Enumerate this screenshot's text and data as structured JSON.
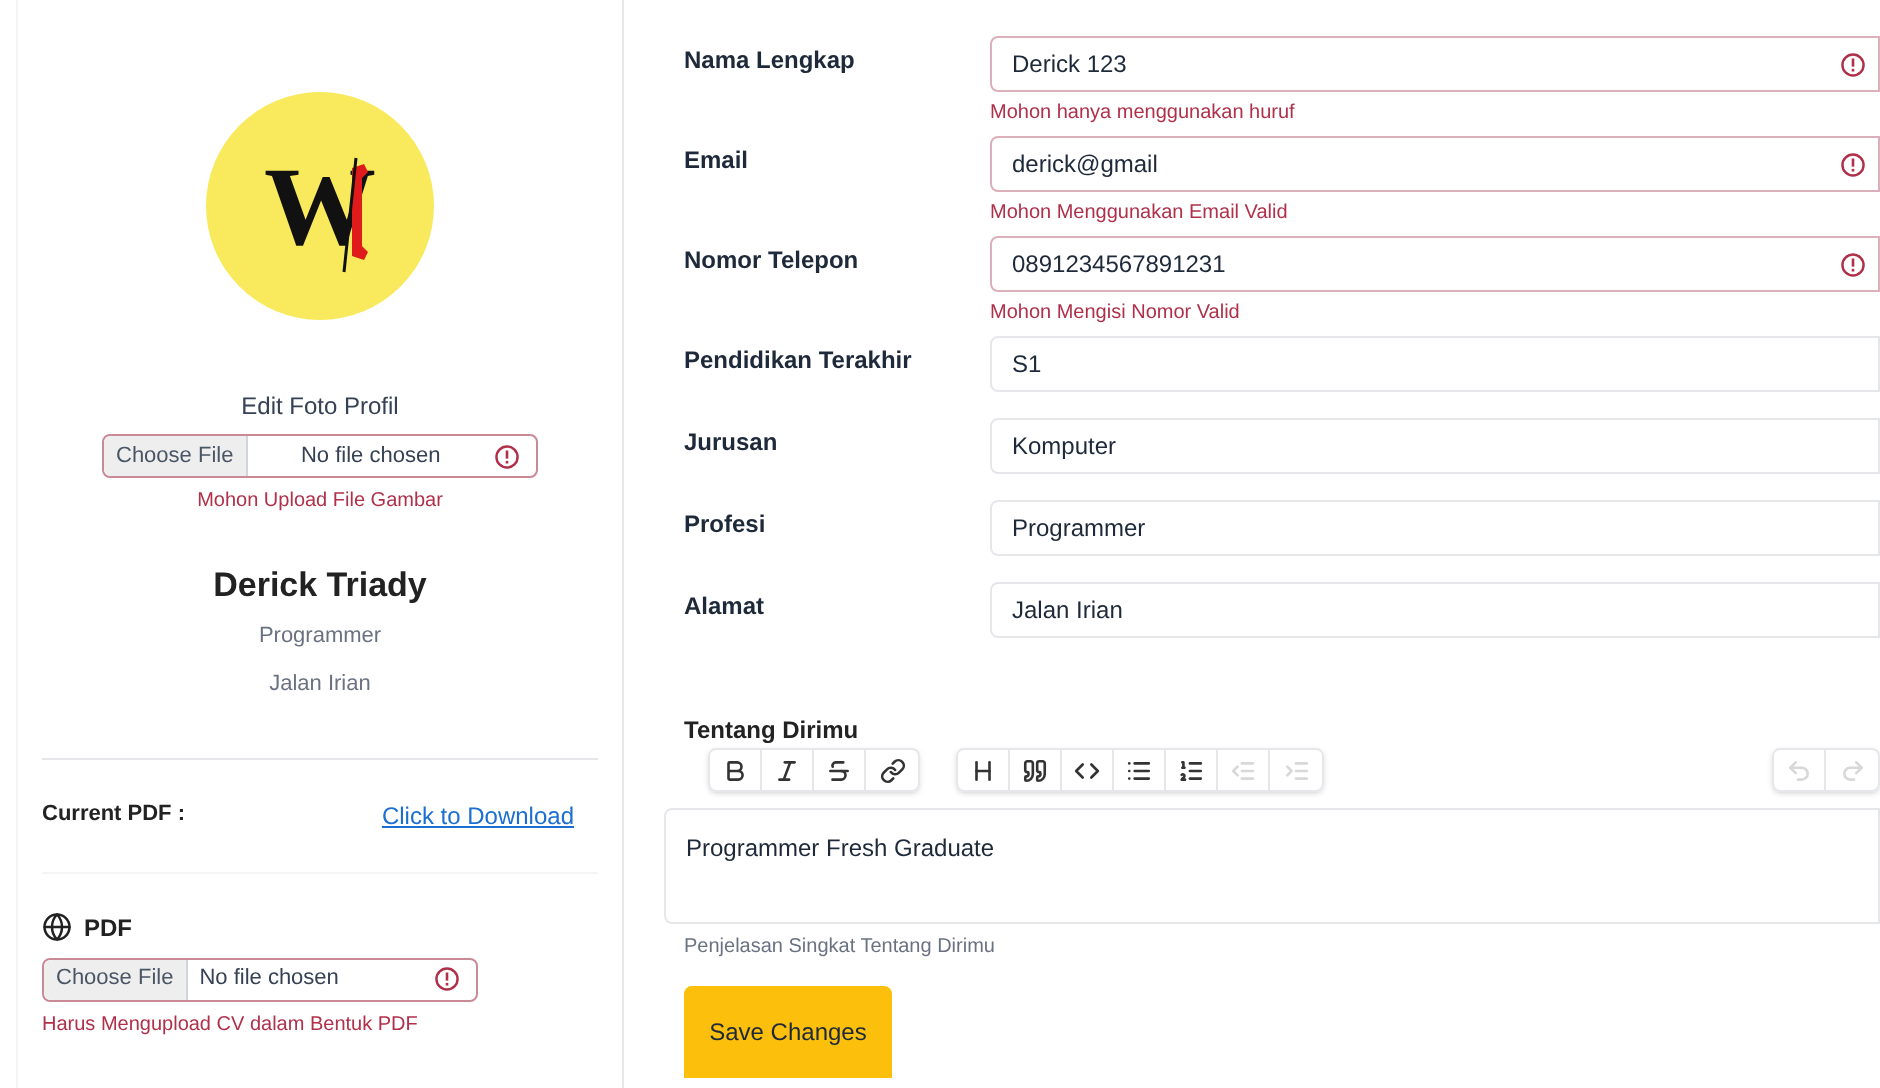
{
  "profile": {
    "logo_letter": "W",
    "photo_label": "Edit Foto Profil",
    "photo_file": {
      "button": "Choose File",
      "value": "No file chosen",
      "invalid": true,
      "error": "Mohon Upload File Gambar"
    },
    "name": "Derick Triady",
    "job": "Programmer",
    "address": "Jalan Irian"
  },
  "pdf": {
    "current_label": "Current PDF :",
    "download_link": "Click to Download",
    "label": "PDF",
    "file": {
      "button": "Choose File",
      "value": "No file chosen",
      "invalid": true,
      "error": "Harus Mengupload CV dalam Bentuk PDF"
    }
  },
  "fields": [
    {
      "label": "Nama Lengkap",
      "value": "Derick 123",
      "invalid": true,
      "error": "Mohon hanya menggunakan huruf"
    },
    {
      "label": "Email",
      "value": "derick@gmail",
      "invalid": true,
      "error": "Mohon Menggunakan Email Valid"
    },
    {
      "label": "Nomor Telepon",
      "value": "0891234567891231",
      "invalid": true,
      "error": "Mohon Mengisi Nomor Valid"
    },
    {
      "label": "Pendidikan Terakhir",
      "value": "S1",
      "invalid": false
    },
    {
      "label": "Jurusan",
      "value": "Komputer",
      "invalid": false
    },
    {
      "label": "Profesi",
      "value": "Programmer",
      "invalid": false
    },
    {
      "label": "Alamat",
      "value": "Jalan Irian",
      "invalid": false
    }
  ],
  "editor": {
    "label": "Tentang Dirimu",
    "toolbar_groups": [
      [
        {
          "kind": "bold",
          "disabled": false
        },
        {
          "kind": "italic",
          "disabled": false
        },
        {
          "kind": "strike",
          "disabled": false
        },
        {
          "kind": "link",
          "disabled": false
        }
      ],
      [
        {
          "kind": "heading",
          "disabled": false
        },
        {
          "kind": "quote",
          "disabled": false
        },
        {
          "kind": "code",
          "disabled": false
        },
        {
          "kind": "bullets",
          "disabled": false
        },
        {
          "kind": "numbers",
          "disabled": false
        },
        {
          "kind": "outdent",
          "disabled": true
        },
        {
          "kind": "indent",
          "disabled": true
        }
      ]
    ],
    "history": [
      {
        "kind": "undo",
        "disabled": true
      },
      {
        "kind": "redo",
        "disabled": true
      }
    ],
    "value": "Programmer Fresh Graduate",
    "hint": "Penjelasan Singkat Tentang Dirimu"
  },
  "save_button": "Save Changes"
}
